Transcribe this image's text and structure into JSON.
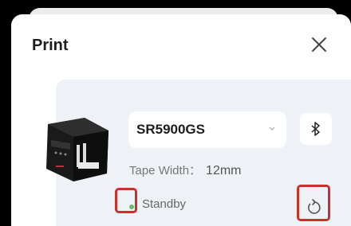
{
  "dialog": {
    "title": "Print",
    "close_icon": "close-icon"
  },
  "printer": {
    "image_icon": "printer-image",
    "model": "SR5900GS",
    "dropdown_icon": "chevron-down-icon",
    "connection_icon": "bluetooth-icon",
    "tape_width_label": "Tape Width：",
    "tape_width_value": "12mm",
    "status_text": "Standby",
    "status_color": "#67b96b",
    "refresh_icon": "refresh-icon"
  },
  "highlight_color": "#c9302c"
}
